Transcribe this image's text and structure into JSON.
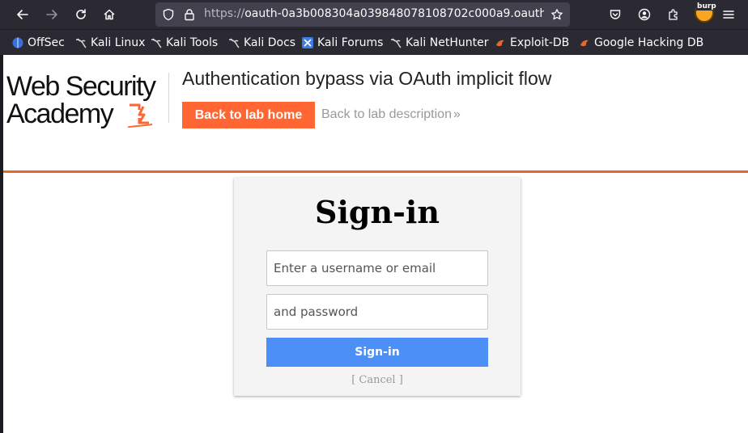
{
  "browser": {
    "url_prefix": "https://",
    "url_host": "oauth-0a3b008304a039848078108702c000a9.oauth",
    "burp_label": "burp"
  },
  "bookmarks": [
    {
      "label": "OffSec"
    },
    {
      "label": "Kali Linux"
    },
    {
      "label": "Kali Tools"
    },
    {
      "label": "Kali Docs"
    },
    {
      "label": "Kali Forums"
    },
    {
      "label": "Kali NetHunter"
    },
    {
      "label": "Exploit-DB"
    },
    {
      "label": "Google Hacking DB"
    }
  ],
  "header": {
    "logo_line1": "Web Security",
    "logo_line2": "Academy",
    "lab_title": "Authentication bypass via OAuth implicit flow",
    "back_home_label": "Back to lab home",
    "back_desc_label": "Back to lab description",
    "chevron": "»"
  },
  "signin": {
    "title": "Sign-in",
    "username_placeholder": "Enter a username or email",
    "password_placeholder": "and password",
    "submit_label": "Sign-in",
    "cancel_label": "[ Cancel ]"
  },
  "colors": {
    "accent_orange": "#ff6633",
    "header_rule": "#e9652c",
    "signin_blue": "#4c8ff7"
  }
}
